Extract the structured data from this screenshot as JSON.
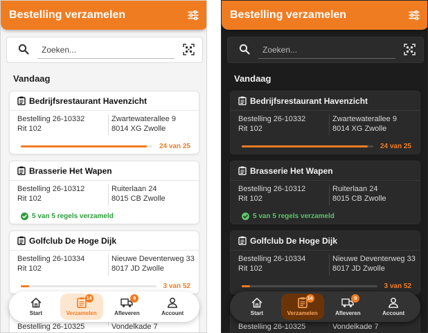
{
  "colors": {
    "accent": "#f07c22",
    "success": "#2e9d3b"
  },
  "appbar": {
    "title": "Bestelling verzamelen",
    "filter_icon": "sliders-icon"
  },
  "search": {
    "placeholder": "Zoeken...",
    "value": "",
    "scan_icon": "qr-scan-icon"
  },
  "section_title": "Vandaag",
  "orders": [
    {
      "customer": "Bedrijfsrestaurant Havenzicht",
      "order": "Bestelling 26-10332",
      "route": "Rit 102",
      "street": "Zwartewaterallee 9",
      "city": "8014 XG Zwolle",
      "progress_text": "24 van 25",
      "progress": 0.96,
      "complete": false
    },
    {
      "customer": "Brasserie Het Wapen",
      "order": "Bestelling 26-10312",
      "route": "Rit 102",
      "street": "Ruiterlaan 24",
      "city": "8015 CB Zwolle",
      "progress_text": "5 van 5 regels verzameld",
      "progress": 1.0,
      "complete": true
    },
    {
      "customer": "Golfclub De Hoge Dijk",
      "order": "Bestelling 26-10334",
      "route": "Rit 102",
      "street": "Nieuwe Deventerweg 33",
      "city": "8017 JD Zwolle",
      "progress_text": "3 van 52",
      "progress": 0.06,
      "complete": false
    },
    {
      "customer": "",
      "order": "Bestelling 26-10325",
      "route": "",
      "street": "Vondelkade 7",
      "city": "",
      "progress_text": "",
      "progress": 0,
      "complete": false
    }
  ],
  "nav": [
    {
      "label": "Start",
      "icon": "home-icon",
      "badge": "",
      "active": false
    },
    {
      "label": "Verzamelen",
      "icon": "clipboard-list-icon",
      "badge": "14",
      "active": true
    },
    {
      "label": "Afleveren",
      "icon": "truck-icon",
      "badge": "9",
      "active": false
    },
    {
      "label": "Account",
      "icon": "person-icon",
      "badge": "",
      "active": false
    }
  ]
}
